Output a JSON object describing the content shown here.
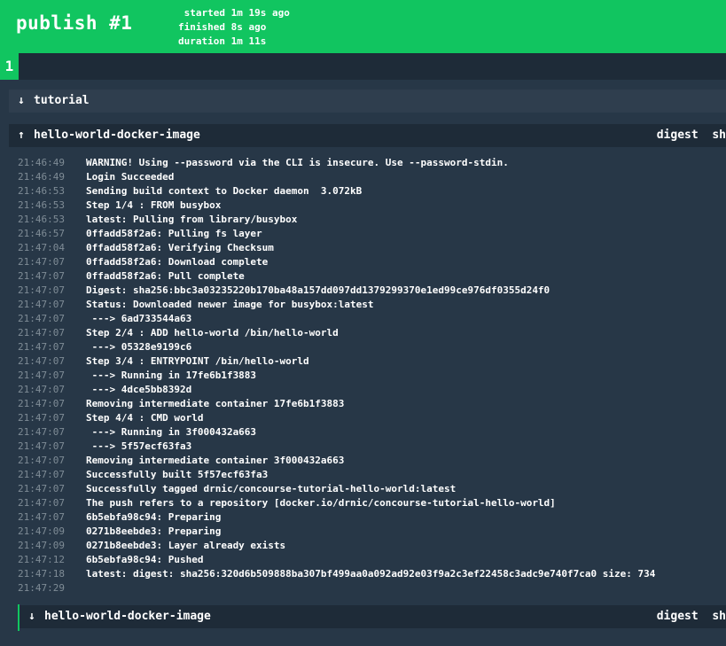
{
  "header": {
    "title": "publish #1",
    "stats": [
      {
        "key": "started",
        "value": "1m 19s ago"
      },
      {
        "key": "finished",
        "value": "8s ago"
      },
      {
        "key": "duration",
        "value": "1m 11s"
      }
    ]
  },
  "builds": {
    "current": "1"
  },
  "steps": {
    "tutorial": {
      "arrow": "↓",
      "name": "tutorial"
    },
    "put": {
      "arrow": "↑",
      "name": "hello-world-docker-image",
      "digest": "digest  sh"
    },
    "get": {
      "arrow": "↓",
      "name": "hello-world-docker-image",
      "digest": "digest  sh"
    }
  },
  "log": [
    {
      "ts": "21:46:49",
      "msg": "WARNING! Using --password via the CLI is insecure. Use --password-stdin."
    },
    {
      "ts": "21:46:49",
      "msg": "Login Succeeded"
    },
    {
      "ts": "21:46:53",
      "msg": "Sending build context to Docker daemon  3.072kB"
    },
    {
      "ts": "21:46:53",
      "msg": "Step 1/4 : FROM busybox"
    },
    {
      "ts": "21:46:53",
      "msg": "latest: Pulling from library/busybox"
    },
    {
      "ts": "21:46:57",
      "msg": "0ffadd58f2a6: Pulling fs layer"
    },
    {
      "ts": "21:47:04",
      "msg": "0ffadd58f2a6: Verifying Checksum"
    },
    {
      "ts": "21:47:07",
      "msg": "0ffadd58f2a6: Download complete"
    },
    {
      "ts": "21:47:07",
      "msg": "0ffadd58f2a6: Pull complete"
    },
    {
      "ts": "21:47:07",
      "msg": "Digest: sha256:bbc3a03235220b170ba48a157dd097dd1379299370e1ed99ce976df0355d24f0"
    },
    {
      "ts": "21:47:07",
      "msg": "Status: Downloaded newer image for busybox:latest"
    },
    {
      "ts": "21:47:07",
      "msg": " ---> 6ad733544a63"
    },
    {
      "ts": "21:47:07",
      "msg": "Step 2/4 : ADD hello-world /bin/hello-world"
    },
    {
      "ts": "21:47:07",
      "msg": " ---> 05328e9199c6"
    },
    {
      "ts": "21:47:07",
      "msg": "Step 3/4 : ENTRYPOINT /bin/hello-world"
    },
    {
      "ts": "21:47:07",
      "msg": " ---> Running in 17fe6b1f3883"
    },
    {
      "ts": "21:47:07",
      "msg": " ---> 4dce5bb8392d"
    },
    {
      "ts": "21:47:07",
      "msg": "Removing intermediate container 17fe6b1f3883"
    },
    {
      "ts": "21:47:07",
      "msg": "Step 4/4 : CMD world"
    },
    {
      "ts": "21:47:07",
      "msg": " ---> Running in 3f000432a663"
    },
    {
      "ts": "21:47:07",
      "msg": " ---> 5f57ecf63fa3"
    },
    {
      "ts": "21:47:07",
      "msg": "Removing intermediate container 3f000432a663"
    },
    {
      "ts": "21:47:07",
      "msg": "Successfully built 5f57ecf63fa3"
    },
    {
      "ts": "21:47:07",
      "msg": "Successfully tagged drnic/concourse-tutorial-hello-world:latest"
    },
    {
      "ts": "21:47:07",
      "msg": "The push refers to a repository [docker.io/drnic/concourse-tutorial-hello-world]"
    },
    {
      "ts": "21:47:07",
      "msg": "6b5ebfa98c94: Preparing"
    },
    {
      "ts": "21:47:09",
      "msg": "0271b8eebde3: Preparing"
    },
    {
      "ts": "21:47:09",
      "msg": "0271b8eebde3: Layer already exists"
    },
    {
      "ts": "21:47:12",
      "msg": "6b5ebfa98c94: Pushed"
    },
    {
      "ts": "21:47:18",
      "msg": "latest: digest: sha256:320d6b509888ba307bf499aa0a092ad92e03f9a2c3ef22458c3adc9e740f7ca0 size: 734"
    },
    {
      "ts": "21:47:29",
      "msg": ""
    }
  ],
  "colors": {
    "succeeded": "#11c560",
    "background": "#273747",
    "bar": "#1e2b38",
    "step_header": "#2f3e4e",
    "timestamp": "#7f8c96"
  }
}
